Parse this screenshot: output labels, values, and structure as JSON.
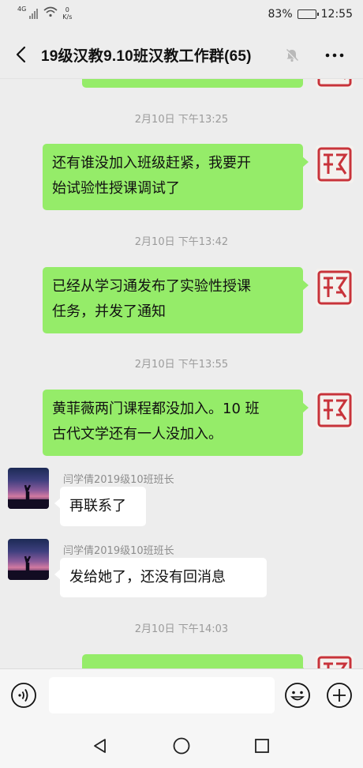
{
  "status_bar": {
    "network": "4G",
    "speed_value": "0",
    "speed_unit": "K/s",
    "battery": "83%",
    "battery_level": 0.83,
    "time": "12:55"
  },
  "header": {
    "title": "19级汉教9.10班汉教工作群(65)"
  },
  "messages": [
    {
      "type": "time",
      "text": "2月10日 下午13:25"
    },
    {
      "type": "sent",
      "lines": [
        "还有谁没加入班级赶紧，我要开",
        "始试验性授课调试了"
      ]
    },
    {
      "type": "time",
      "text": "2月10日 下午13:42"
    },
    {
      "type": "sent",
      "lines": [
        "已经从学习通发布了实验性授课",
        "任务，并发了通知"
      ]
    },
    {
      "type": "time",
      "text": "2月10日 下午13:55"
    },
    {
      "type": "sent",
      "lines": [
        "黄菲薇两门课程都没加入。10 班",
        "古代文学还有一人没加入。"
      ]
    },
    {
      "type": "received",
      "sender": "闫学倩2019级10班班长",
      "lines": [
        "再联系了"
      ]
    },
    {
      "type": "received",
      "sender": "闫学倩2019级10班班长",
      "lines": [
        "发给她了，还没有回消息"
      ]
    },
    {
      "type": "time",
      "text": "2月10日 下午14:03"
    }
  ],
  "colors": {
    "sent_bubble": "#95ec69",
    "received_bubble": "#ffffff",
    "background": "#ededed",
    "seal_red": "#c8333a"
  },
  "icons": {
    "back": "back-icon",
    "mute": "mute-icon",
    "more": "more-icon",
    "voice": "voice-icon",
    "emoji": "emoji-icon",
    "plus": "plus-icon"
  }
}
